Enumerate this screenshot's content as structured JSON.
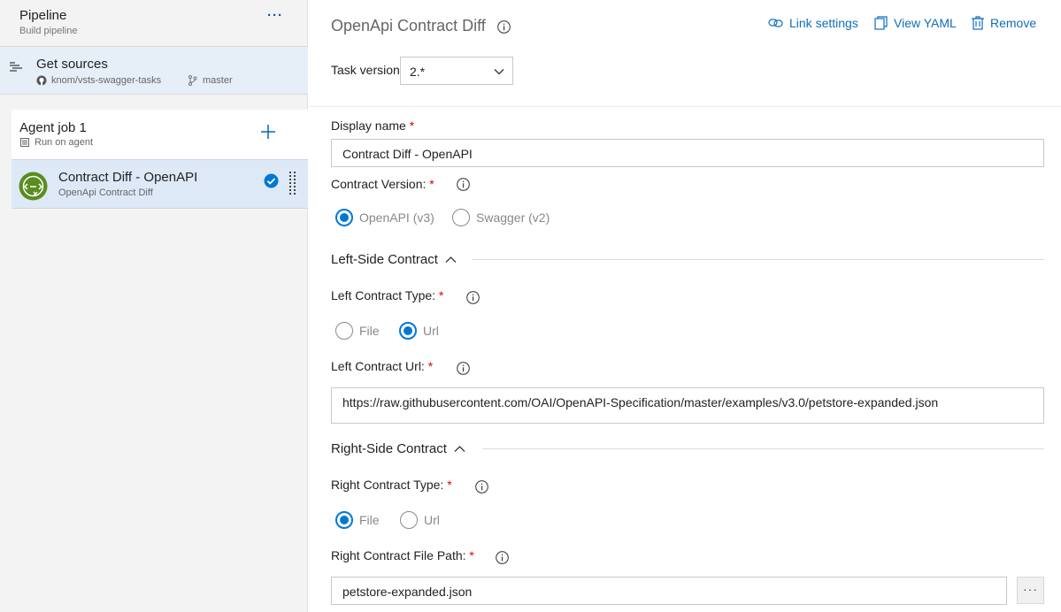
{
  "pipeline": {
    "title": "Pipeline",
    "subtitle": "Build pipeline",
    "more_label": "···"
  },
  "get_sources": {
    "title": "Get sources",
    "repo": "knom/vsts-swagger-tasks",
    "branch": "master"
  },
  "agent_job": {
    "title": "Agent job 1",
    "subtitle": "Run on agent"
  },
  "task": {
    "title": "Contract Diff - OpenAPI",
    "subtitle": "OpenApi Contract Diff"
  },
  "header": {
    "title": "OpenApi Contract Diff",
    "link_settings": "Link settings",
    "view_yaml": "View YAML",
    "remove": "Remove"
  },
  "form": {
    "task_version": {
      "label": "Task version",
      "value": "2.*"
    },
    "display_name": {
      "label": "Display name",
      "required": "*",
      "value": "Contract Diff  - OpenAPI"
    },
    "contract_version": {
      "label": "Contract Version:",
      "required": "*",
      "options": [
        "OpenAPI (v3)",
        "Swagger (v2)"
      ],
      "selected": "OpenAPI (v3)"
    },
    "left_section": {
      "title": "Left-Side Contract",
      "type": {
        "label": "Left Contract Type:",
        "required": "*",
        "options": [
          "File",
          "Url"
        ],
        "selected": "Url"
      },
      "url": {
        "label": "Left Contract Url:",
        "required": "*",
        "value": "https://raw.githubusercontent.com/OAI/OpenAPI-Specification/master/examples/v3.0/petstore-expanded.json"
      }
    },
    "right_section": {
      "title": "Right-Side Contract",
      "type": {
        "label": "Right Contract Type:",
        "required": "*",
        "options": [
          "File",
          "Url"
        ],
        "selected": "File"
      },
      "path": {
        "label": "Right Contract File Path:",
        "required": "*",
        "value": "petstore-expanded.json"
      },
      "browse_label": "···"
    }
  },
  "colors": {
    "accent": "#0078d4",
    "link": "#106ebe",
    "selected_bg": "#dde9f7",
    "task_icon": "#5b8c1f",
    "required": "#dd0000"
  },
  "icons": {
    "sources": "get-sources-icon",
    "repo": "github-icon",
    "branch": "branch-icon",
    "agent": "agent-icon",
    "task": "contract-diff-icon",
    "check": "check-circle-icon",
    "info": "info-icon",
    "link": "link-icon",
    "yaml": "clipboard-icon",
    "remove": "trash-icon"
  }
}
